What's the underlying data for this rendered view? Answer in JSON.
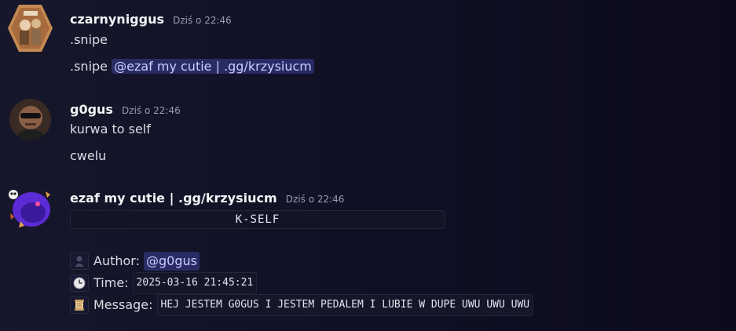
{
  "messages": [
    {
      "username": "czarnyniggus",
      "timestamp": "Dziś o 22:46",
      "lines": [
        ".snipe",
        ".snipe "
      ],
      "mention": "@ezaf my cutie | .gg/krzysiucm"
    },
    {
      "username": "g0gus",
      "timestamp": "Dziś o 22:46",
      "lines": [
        "kurwa to self",
        "cwelu"
      ]
    },
    {
      "username": "ezaf my cutie | .gg/krzysiucm",
      "timestamp": "Dziś o 22:46",
      "codeblock": "K-SELF",
      "embed": {
        "author_label": "Author:",
        "author_mention": "@g0gus",
        "time_label": "Time:",
        "time_value": "2025-03-16 21:45:21",
        "message_label": "Message:",
        "message_value": "HEJ JESTEM G0GUS I JESTEM PEDALEM I LUBIE W DUPE UWU UWU UWU"
      }
    }
  ],
  "icons": {
    "author": "bust-silhouette-icon",
    "time": "clock-icon",
    "message": "scroll-icon"
  },
  "colors": {
    "mention_bg": "#3a3f7a",
    "mention_text": "#c9cdfb",
    "timestamp": "#9a9caf"
  }
}
